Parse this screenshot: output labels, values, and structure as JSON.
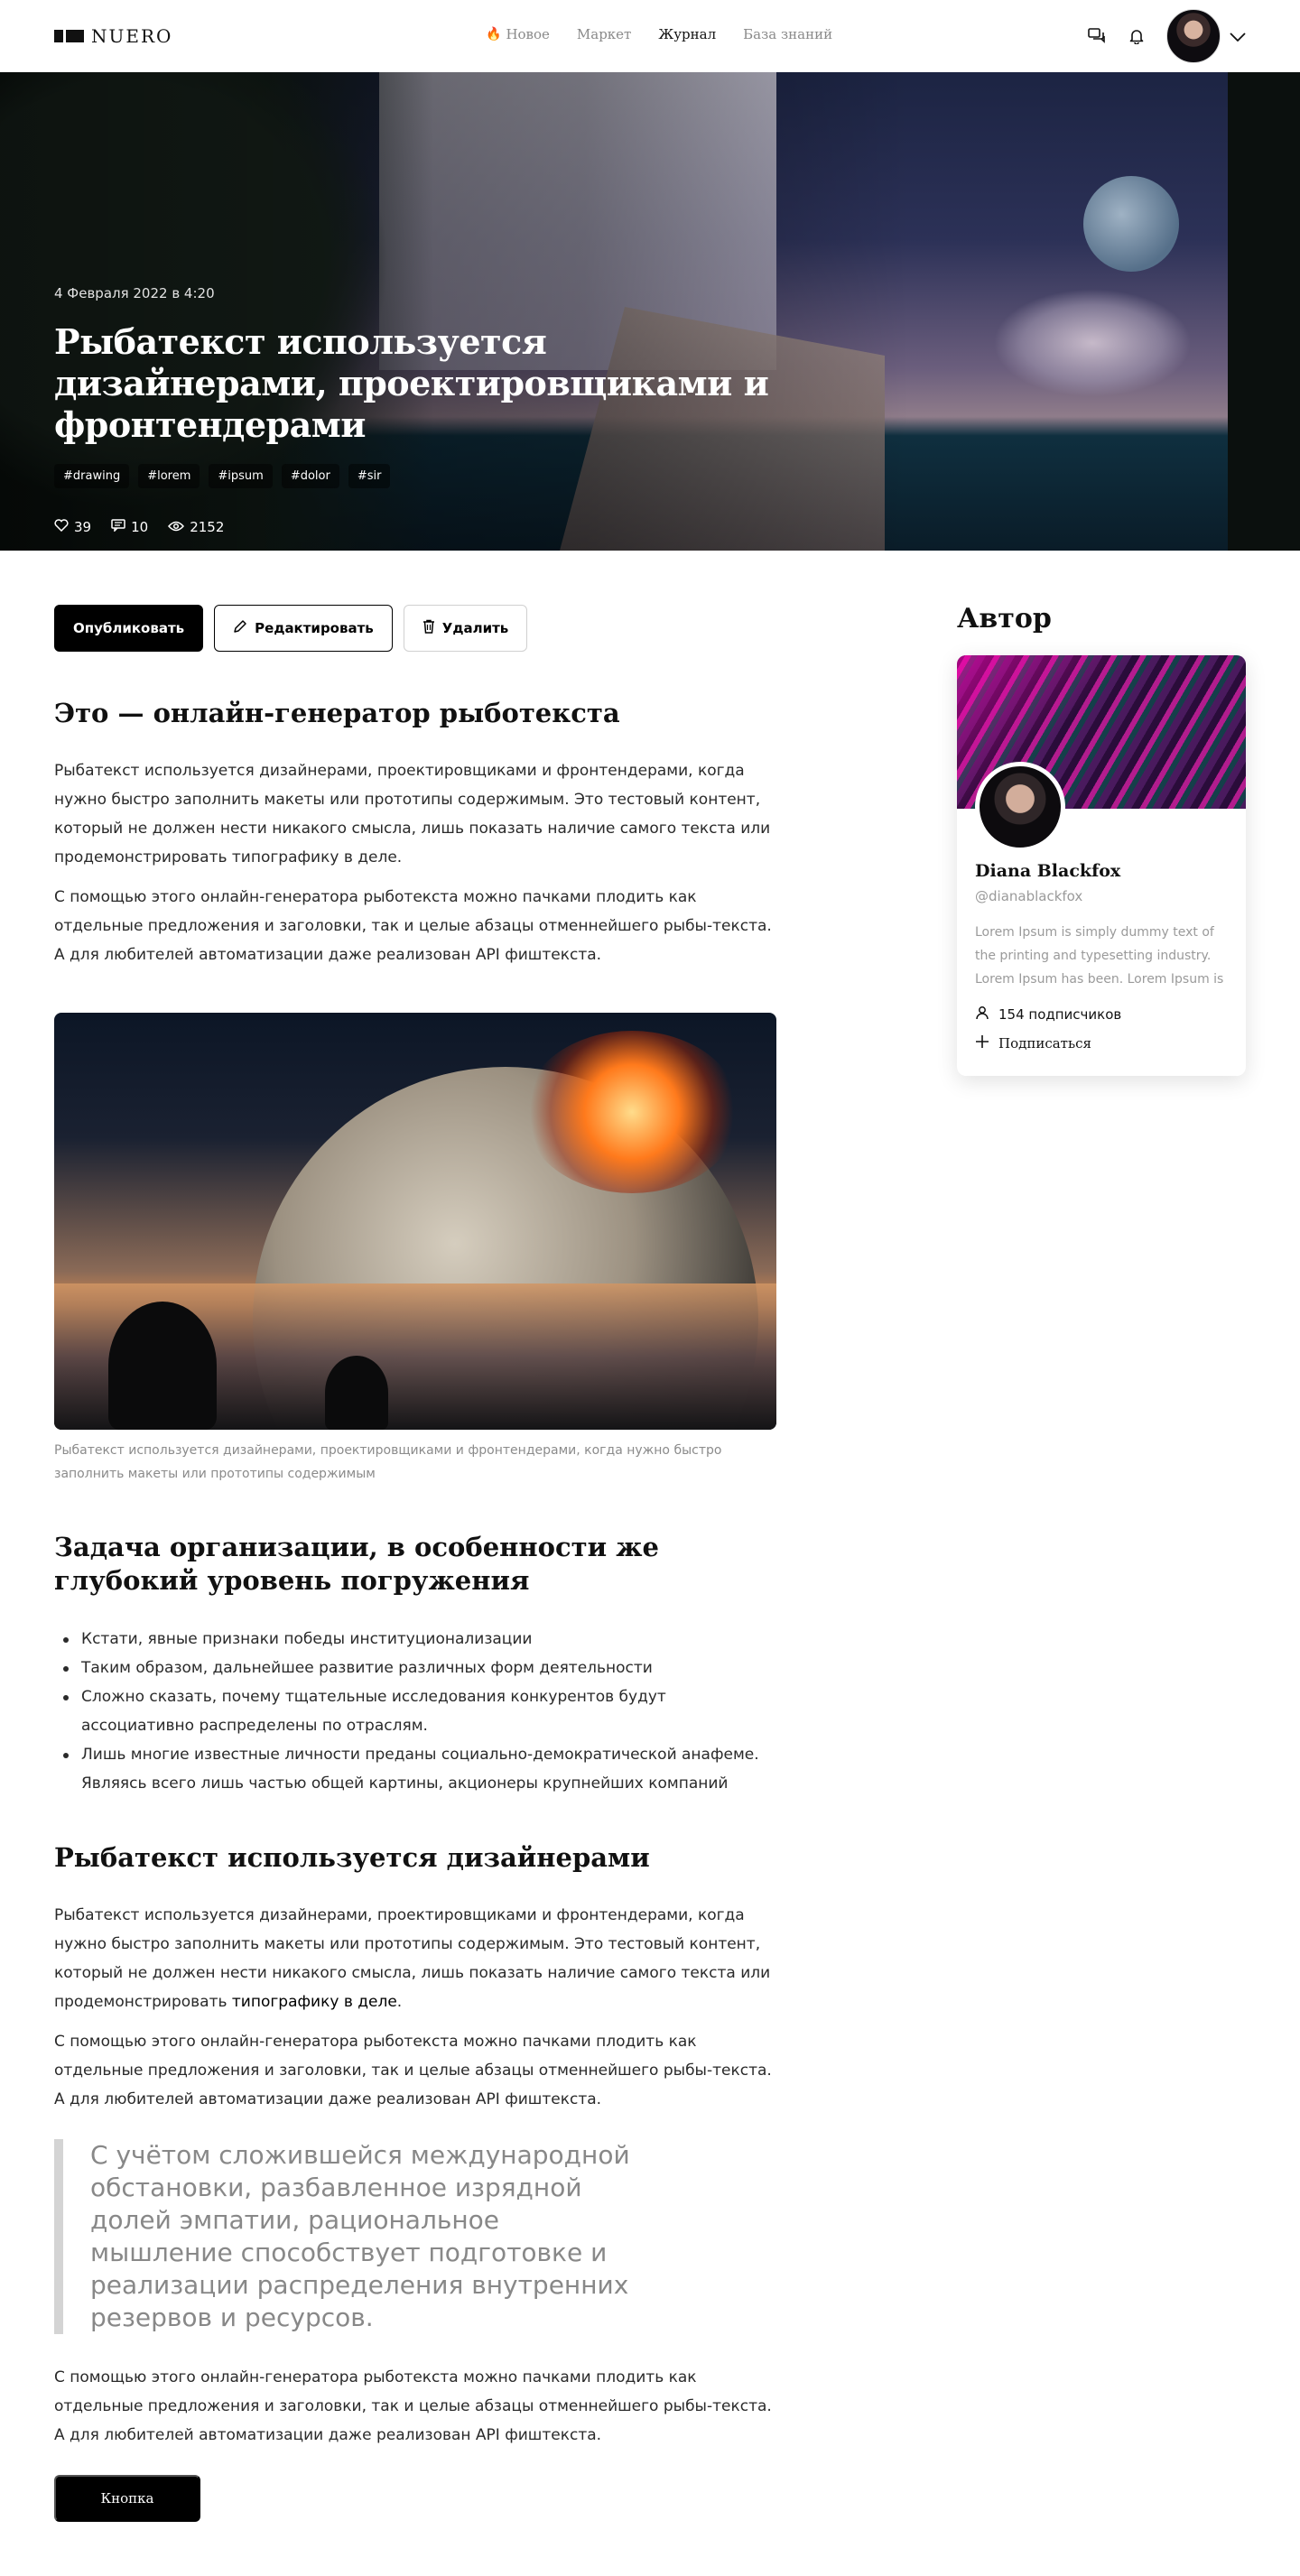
{
  "brand": {
    "name": "NUERO"
  },
  "nav": {
    "items": [
      {
        "label": "Новое"
      },
      {
        "label": "Маркет"
      },
      {
        "label": "Журнал"
      },
      {
        "label": "База знаний"
      }
    ]
  },
  "header_icons": [
    "chat-icon",
    "bell-icon",
    "avatar",
    "chevron-down-icon"
  ],
  "hero": {
    "date": "4 Февраля 2022 в 4:20",
    "title": "Рыбатекст используется дизайнерами, проектировщиками и фронтендерами",
    "tags": [
      "#drawing",
      "#lorem",
      "#ipsum",
      "#dolor",
      "#sir"
    ],
    "likes": "39",
    "comments": "10",
    "views": "2152"
  },
  "actions": {
    "publish": "Опубликовать",
    "edit": "Редактировать",
    "delete": "Удалить"
  },
  "article": {
    "h1": "Это — онлайн-генератор рыботекста",
    "p1": "Рыбатекст используется дизайнерами, проектировщиками и фронтендерами, когда нужно быстро заполнить макеты или прототипы содержимым. Это тестовый контент, который не должен нести никакого смысла, лишь показать наличие самого текста или продемонстрировать типографику в деле.",
    "p2": "С помощью этого онлайн-генератора рыботекста можно пачками плодить как отдельные предложения и заголовки, так и целые абзацы отменнейшего рыбы-текста. А для любителей автоматизации даже реализован API фиштекста.",
    "caption": "Рыбатекст используется дизайнерами, проектировщиками и фронтендерами, когда нужно быстро заполнить макеты или прототипы содержимым",
    "h2": "Задача организации, в особенности же глубокий уровень погружения",
    "list": [
      "Кстати, явные признаки победы институционализации",
      "Таким образом, дальнейшее развитие различных форм деятельности",
      "Сложно сказать, почему тщательные исследования конкурентов будут ассоциативно распределены по отраслям.",
      "Лишь многие известные личности преданы социально-демократической анафеме. Являясь всего лишь частью общей картины, акционеры крупнейших компаний"
    ],
    "h3": "Рыбатекст используется дизайнерами",
    "p3_before_link": "Рыбатекст используется дизайнерами, проектировщиками и фронтендерами, когда нужно быстро заполнить макеты или прототипы содержимым. Это тестовый контент, который не должен нести никакого смысла, лишь показать наличие самого текста или продемонстрировать ",
    "p3_link": "типографику в деле",
    "p3_after_link": ".",
    "p4": "С помощью этого онлайн-генератора рыботекста можно пачками плодить как отдельные предложения и заголовки, так и целые абзацы отменнейшего рыбы-текста. А для любителей автоматизации даже реализован API фиштекста.",
    "quote": "С учётом сложившейся международной обстановки, разбавленное изрядной долей эмпатии, рациональное мышление способствует подготовке и реализации распределения внутренних резервов и ресурсов.",
    "p5": "С помощью этого онлайн-генератора рыботекста можно пачками плодить как отдельные предложения и заголовки, так и целые абзацы отменнейшего рыбы-текста. А для любителей автоматизации даже реализован API фиштекста.",
    "button": "Кнопка"
  },
  "sidebar": {
    "title": "Автор",
    "author_name": "Diana Blackfox",
    "author_handle": "@dianablackfox",
    "bio": "Lorem Ipsum is simply dummy text of the printing and typesetting industry. Lorem Ipsum has been. Lorem Ipsum is",
    "followers": "154 подписчиков",
    "subscribe": "Подписаться"
  },
  "colors": {
    "accent": "#000000",
    "fire": "#ff5a1f",
    "muted": "#8a8a8a"
  }
}
